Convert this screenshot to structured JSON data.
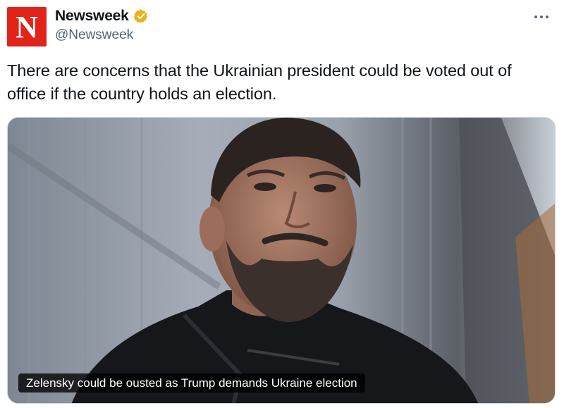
{
  "account": {
    "display_name": "Newsweek",
    "handle": "@Newsweek",
    "avatar_letter": "N",
    "avatar_color": "#e2231a",
    "verified_badge_icon": "gold-verified-badge-icon",
    "verified_badge_color": "#e8b41f"
  },
  "menu": {
    "more_icon": "more-options-icon"
  },
  "tweet": {
    "text": "There are concerns that the Ukrainian president could be voted out of office if the country holds an election."
  },
  "media": {
    "caption": "Zelensky could be ousted as Trump demands Ukraine election"
  },
  "colors": {
    "text_primary": "#0f1419",
    "text_secondary": "#536471",
    "border": "#cfd9de"
  }
}
